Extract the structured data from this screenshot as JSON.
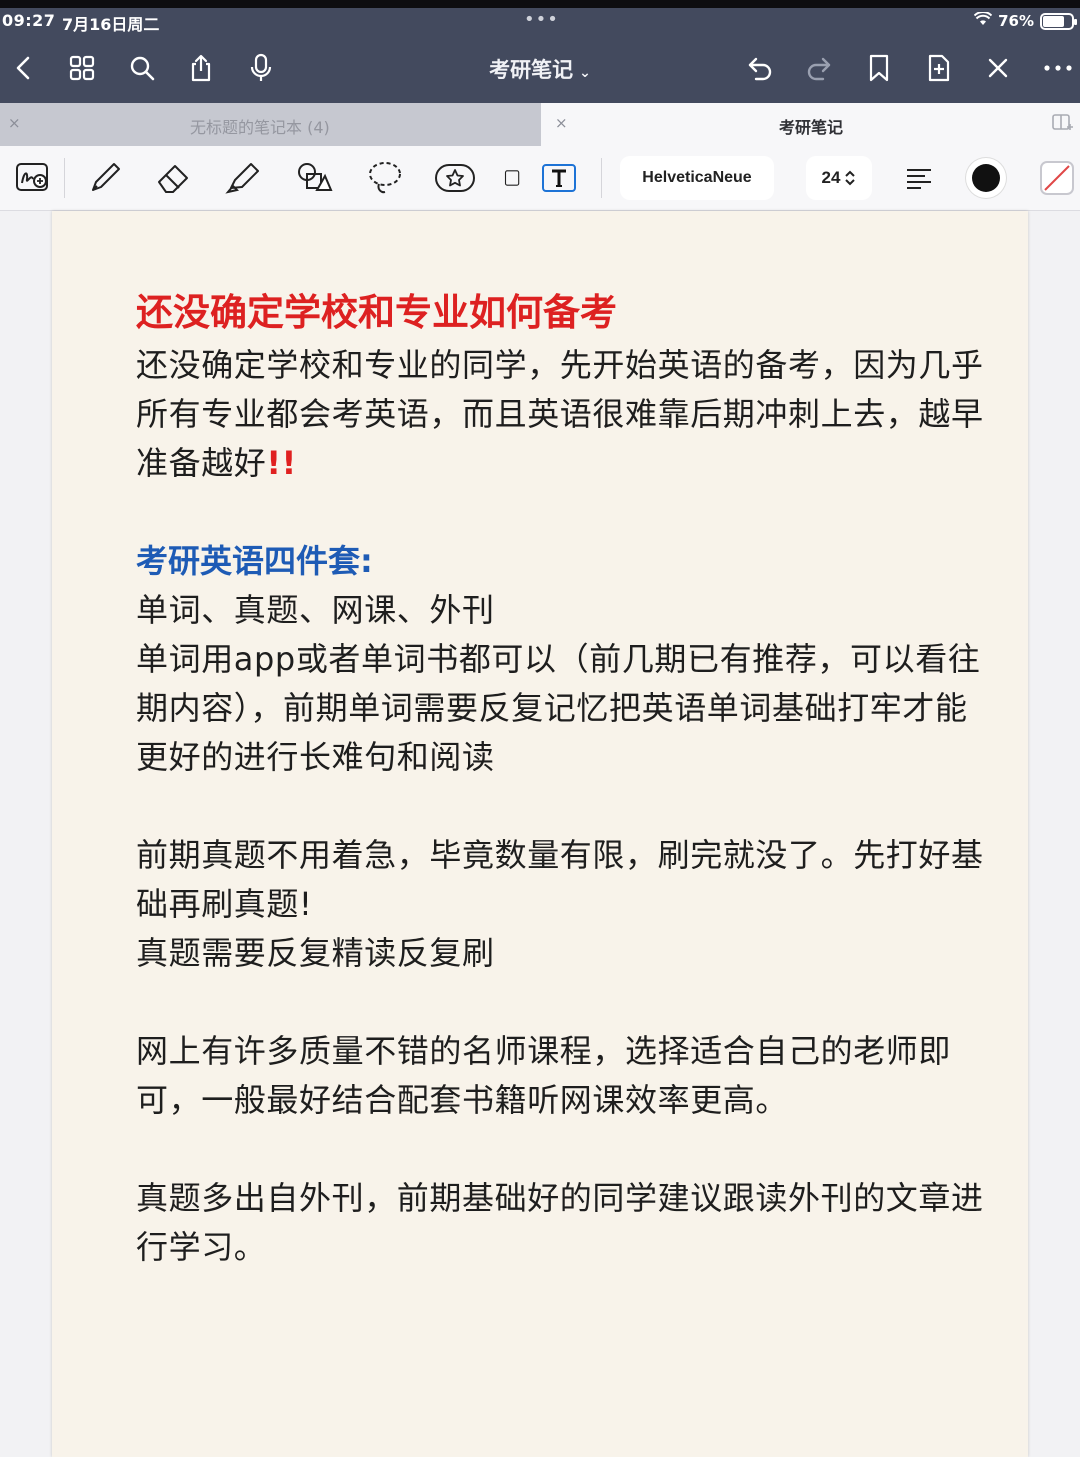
{
  "status_bar": {
    "time": "09:27",
    "date": "7月16日周二",
    "dots": "•••",
    "battery": "76%",
    "battery_level": 0.76
  },
  "nav": {
    "title": "考研笔记",
    "icons": [
      "back-icon",
      "grid-icon",
      "search-icon",
      "share-icon",
      "microphone-icon",
      "undo-icon",
      "redo-icon",
      "bookmark-icon",
      "add-page-icon",
      "close-icon",
      "more-icon"
    ]
  },
  "tabs": [
    {
      "label": "无标题的笔记本 (4)",
      "close": "×",
      "active": false
    },
    {
      "label": "考研笔记",
      "close": "×",
      "active": true
    }
  ],
  "toolbar": {
    "font": "HelveticaNeue",
    "size": "24",
    "color": "#111111",
    "tools": [
      "handwriting-insert-icon",
      "pen-icon",
      "eraser-icon",
      "highlighter-icon",
      "shapes-icon",
      "lasso-icon",
      "sticker-icon",
      "image-icon",
      "text-icon"
    ]
  },
  "note": {
    "heading": "还没确定学校和专业如何备考",
    "intro": "还没确定学校和专业的同学，先开始英语的备考，因为几乎所有专业都会考英语，而且英语很难靠后期冲刺上去，越早准备越好",
    "intro_mark": "!!",
    "subheading": "考研英语四件套:",
    "list_line": "单词、真题、网课、外刊",
    "words_para": "单词用app或者单词书都可以（前几期已有推荐，可以看往期内容），前期单词需要反复记忆把英语单词基础打牢才能更好的进行长难句和阅读",
    "exam_para_1": "前期真题不用着急，毕竟数量有限，刷完就没了。先打好基础再刷真题!",
    "exam_para_2": "真题需要反复精读反复刷",
    "course_para": "网上有许多质量不错的名师课程，选择适合自己的老师即可，一般最好结合配套书籍听网课效率更高。",
    "journal_para": "真题多出自外刊，前期基础好的同学建议跟读外刊的文章进行学习。"
  },
  "colors": {
    "header_bg": "#434a5e",
    "heading_red": "#dd2121",
    "subheading_blue": "#1e5bb5",
    "paper": "#f8f3ea"
  }
}
